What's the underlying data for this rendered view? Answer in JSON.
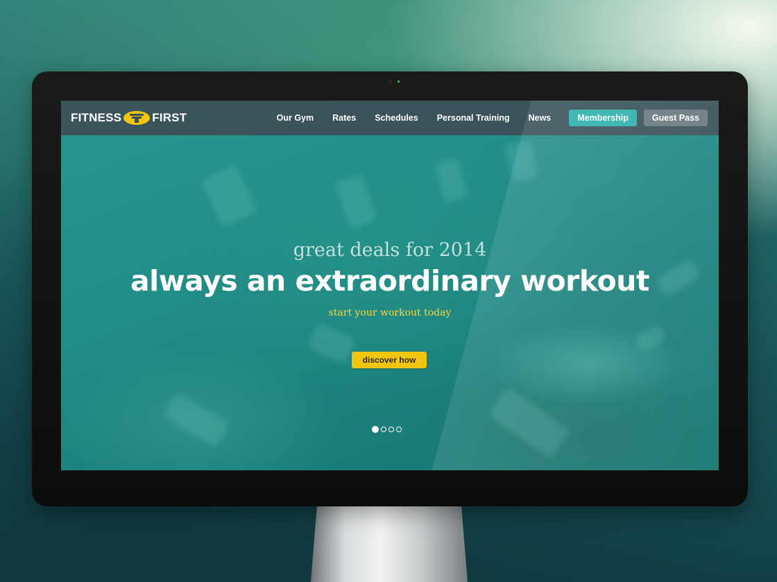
{
  "brand": {
    "name_left": "FITNESS",
    "name_right": "FIRST",
    "accent_yellow": "#f2c50e",
    "accent_teal": "#2fb1ac"
  },
  "nav": {
    "links": [
      "Our Gym",
      "Rates",
      "Schedules",
      "Personal Training",
      "News"
    ],
    "membership_label": "Membership",
    "guest_pass_label": "Guest Pass"
  },
  "hero": {
    "subtitle": "great deals for 2014",
    "title": "always an extraordinary workout",
    "tagline": "start your workout today",
    "cta_label": "discover how",
    "slides_count": 4,
    "active_slide": 1
  }
}
